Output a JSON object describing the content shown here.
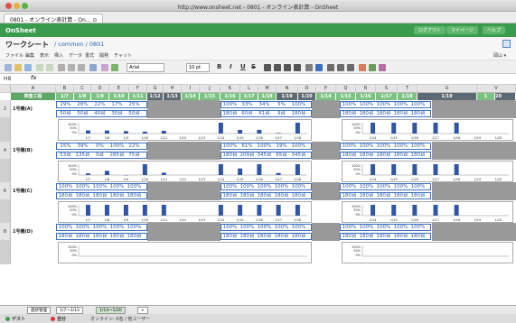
{
  "window": {
    "title": "http://www.onsheet.net - 0801 - オンライン表計算 - OnSheet",
    "tab": "0801 - オンライン表計算 - On... ⊙"
  },
  "app": {
    "brand": "OnSheet",
    "right_buttons": [
      "ログアウト",
      "マイページ",
      "ヘルプ"
    ]
  },
  "page": {
    "title": "ワークシート",
    "crumb": "/ common / 0801"
  },
  "menu": [
    "ファイル",
    "編集",
    "表示",
    "挿入",
    "データ",
    "書式",
    "開発",
    "チャット"
  ],
  "menu_right": "岡山 ▾",
  "toolbar": {
    "font": "Arial",
    "size": "10 pt",
    "format": [
      "B",
      "I",
      "U",
      "S"
    ]
  },
  "formula": {
    "ref": "H8",
    "fx": "fx"
  },
  "columns": [
    "A",
    "B",
    "C",
    "D",
    "E",
    "F",
    "G",
    "H",
    "I",
    "J",
    "K",
    "L",
    "M",
    "N",
    "O",
    "P",
    "Q",
    "R",
    "S",
    "T",
    "U",
    "V"
  ],
  "dates": [
    "1/7",
    "1/8",
    "1/9",
    "1/10",
    "1/11",
    "1/12",
    "1/13",
    "1/14",
    "1/15",
    "1/16",
    "1/17",
    "1/18",
    "1/19",
    "1/20",
    "1/14",
    "1/15",
    "1/16",
    "1/17",
    "1/18",
    "1/19",
    "1/20",
    "1"
  ],
  "header_label": "検査工程",
  "rows": [
    {
      "num": "2",
      "label": "1号機(A)",
      "pct": [
        "29%",
        "28%",
        "22%",
        "17%",
        "25%"
      ],
      "mid_pct": [
        "100%",
        "33%",
        "34%",
        "5%",
        "100%"
      ],
      "right_pct": [
        "100%",
        "100%",
        "100%",
        "100%",
        "100%"
      ],
      "qty": [
        "50台",
        "50台",
        "40台",
        "30台",
        "50台"
      ],
      "mid_qty": [
        "180台",
        "60台",
        "61台",
        "9台",
        "180台"
      ],
      "right_qty": [
        "180台",
        "180台",
        "180台",
        "180台",
        "180台"
      ]
    },
    {
      "num": "4",
      "label": "1号機(B)",
      "pct": [
        "15%",
        "39%",
        "0%",
        "100%",
        "22%"
      ],
      "mid_pct": [
        "100%",
        "61%",
        "100%",
        "19%",
        "100%"
      ],
      "right_pct": [
        "100%",
        "100%",
        "100%",
        "100%",
        "100%"
      ],
      "qty": [
        "53台",
        "135台",
        "0台",
        "285台",
        "75台"
      ],
      "mid_qty": [
        "180台",
        "209台",
        "345台",
        "65台",
        "345台"
      ],
      "right_qty": [
        "180台",
        "180台",
        "180台",
        "180台",
        "180台"
      ]
    },
    {
      "num": "6",
      "label": "1号機(C)",
      "pct": [
        "100%",
        "100%",
        "100%",
        "100%",
        "100%"
      ],
      "mid_pct": [
        "100%",
        "100%",
        "100%",
        "100%",
        "100%"
      ],
      "right_pct": [
        "100%",
        "100%",
        "100%",
        "100%",
        "100%"
      ],
      "qty": [
        "180台",
        "180台",
        "180台",
        "180台",
        "180台"
      ],
      "mid_qty": [
        "180台",
        "180台",
        "180台",
        "180台",
        "180台"
      ],
      "right_qty": [
        "180台",
        "180台",
        "180台",
        "180台",
        "180台"
      ]
    },
    {
      "num": "8",
      "label": "1号機(D)",
      "pct": [
        "100%",
        "100%",
        "100%",
        "100%",
        "100%"
      ],
      "mid_pct": [
        "100%",
        "100%",
        "100%",
        "100%",
        "100%"
      ],
      "right_pct": [
        "100%",
        "100%",
        "100%",
        "100%",
        "100%"
      ],
      "qty": [
        "180台",
        "180台",
        "180台",
        "180台",
        "180台"
      ],
      "mid_qty": [
        "180台",
        "180台",
        "180台",
        "180台",
        "180台"
      ],
      "right_qty": [
        "180台",
        "180台",
        "180台",
        "180台",
        "180台"
      ]
    }
  ],
  "chart_axis": {
    "ytop": "100%",
    "ymid": "50%",
    "ybot": "0%"
  },
  "chart_dates_left": [
    "1/7",
    "1/8",
    "1/9",
    "1/10",
    "1/11",
    "1/12",
    "1/13"
  ],
  "chart_dates_mid": [
    "1/14",
    "1/15",
    "1/16",
    "1/17",
    "1/18"
  ],
  "chart_dates_right": [
    "1/14",
    "1/15",
    "1/16",
    "1/17",
    "1/18",
    "1/19",
    "1/20"
  ],
  "chart_data": [
    {
      "type": "bar",
      "categories": [
        "1/7",
        "1/8",
        "1/9",
        "1/10",
        "1/11",
        "1/12",
        "1/13"
      ],
      "values": [
        29,
        28,
        22,
        17,
        25,
        null,
        null
      ],
      "ylim": [
        0,
        100
      ]
    },
    {
      "type": "bar",
      "categories": [
        "1/14",
        "1/15",
        "1/16",
        "1/17",
        "1/18"
      ],
      "values": [
        100,
        33,
        34,
        5,
        100
      ],
      "ylim": [
        0,
        100
      ]
    },
    {
      "type": "bar",
      "categories": [
        "1/14",
        "1/15",
        "1/16",
        "1/17",
        "1/18",
        "1/19",
        "1/20"
      ],
      "values": [
        100,
        100,
        100,
        100,
        100,
        null,
        null
      ],
      "ylim": [
        0,
        100
      ]
    },
    {
      "type": "bar",
      "categories": [
        "1/7",
        "1/8",
        "1/9",
        "1/10",
        "1/11",
        "1/12",
        "1/13"
      ],
      "values": [
        15,
        39,
        0,
        100,
        22,
        null,
        null
      ],
      "ylim": [
        0,
        100
      ]
    },
    {
      "type": "bar",
      "categories": [
        "1/14",
        "1/15",
        "1/16",
        "1/17",
        "1/18"
      ],
      "values": [
        100,
        61,
        100,
        19,
        100
      ],
      "ylim": [
        0,
        100
      ]
    },
    {
      "type": "bar",
      "categories": [
        "1/14",
        "1/15",
        "1/16",
        "1/17",
        "1/18",
        "1/19",
        "1/20"
      ],
      "values": [
        100,
        100,
        100,
        100,
        100,
        null,
        null
      ],
      "ylim": [
        0,
        100
      ]
    },
    {
      "type": "bar",
      "categories": [
        "1/7",
        "1/8",
        "1/9",
        "1/10",
        "1/11",
        "1/12",
        "1/13"
      ],
      "values": [
        100,
        100,
        100,
        100,
        100,
        null,
        null
      ],
      "ylim": [
        0,
        100
      ]
    },
    {
      "type": "bar",
      "categories": [
        "1/14",
        "1/15",
        "1/16",
        "1/17",
        "1/18"
      ],
      "values": [
        100,
        100,
        100,
        100,
        100
      ],
      "ylim": [
        0,
        100
      ]
    },
    {
      "type": "bar",
      "categories": [
        "1/14",
        "1/15",
        "1/16",
        "1/17",
        "1/18",
        "1/19",
        "1/20"
      ],
      "values": [
        100,
        100,
        100,
        100,
        100,
        null,
        null
      ],
      "ylim": [
        0,
        100
      ]
    }
  ],
  "sheets": [
    "進捗管理",
    "1/7〜1/13",
    "1/14〜1/20",
    "+"
  ],
  "status": {
    "user1": "ゲスト",
    "user2": "自分",
    "msg": "オンライン: 0名 / 他ユーザー"
  }
}
